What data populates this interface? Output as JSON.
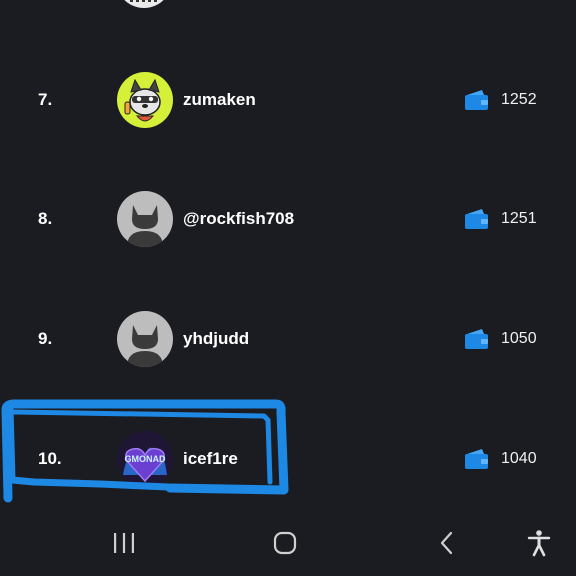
{
  "leaderboard": {
    "rows": [
      {
        "rank": "7.",
        "username": "zumaken",
        "score": "1252",
        "avatar_icon": "raccoon-mascot-avatar"
      },
      {
        "rank": "8.",
        "username": "@rockfish708",
        "score": "1251",
        "avatar_icon": "default-cat-avatar"
      },
      {
        "rank": "9.",
        "username": "yhdjudd",
        "score": "1050",
        "avatar_icon": "default-cat-avatar"
      },
      {
        "rank": "10.",
        "username": "icef1re",
        "score": "1040",
        "avatar_icon": "gmonad-heart-avatar"
      }
    ],
    "score_icon": "wallet-icon"
  },
  "avatar_labels": {
    "gmonad": "GMONAD"
  },
  "highlight": {
    "color": "#1e88e5",
    "target_row": "10."
  },
  "nav": {
    "recents_icon": "recents-icon",
    "home_icon": "home-icon",
    "back_icon": "back-icon",
    "accessibility_icon": "accessibility-icon"
  },
  "colors": {
    "background": "#1b1c21",
    "accent_wallet": "#1e88e5",
    "text": "#ffffff"
  }
}
